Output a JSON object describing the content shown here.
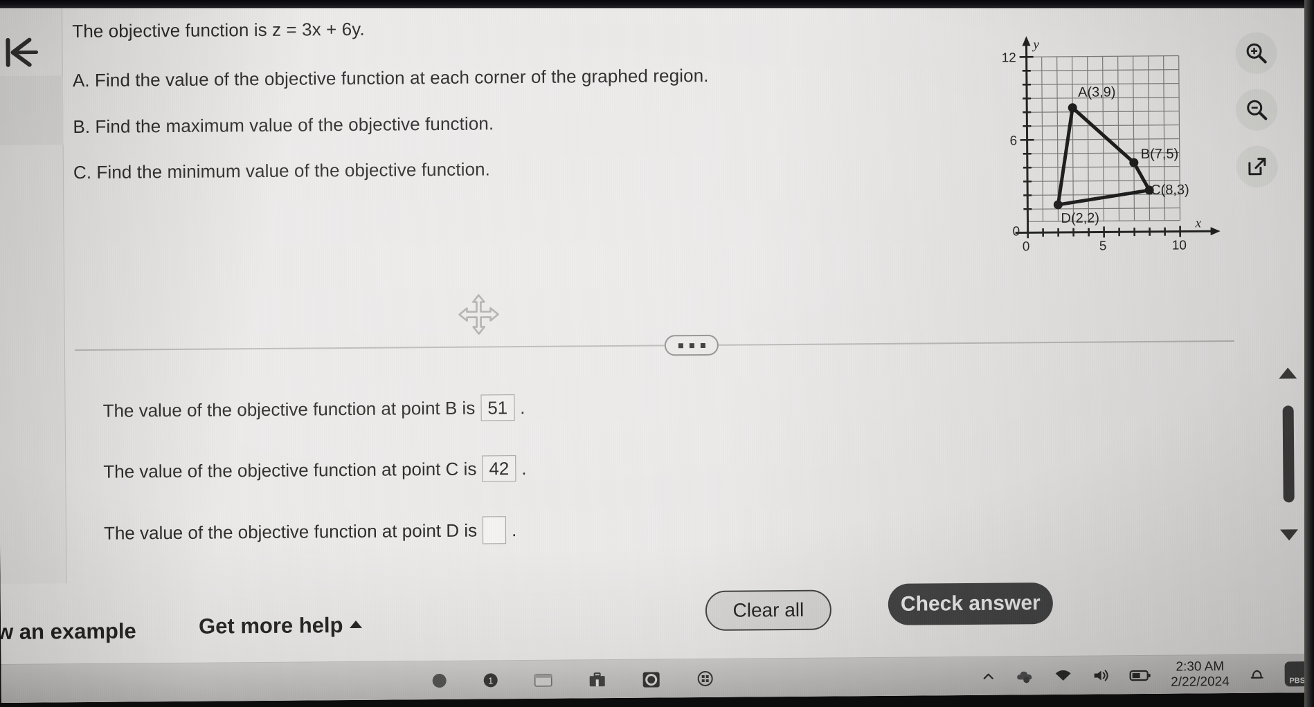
{
  "question": {
    "objective_line": "The objective function is z = 3x + 6y.",
    "parts": [
      "A. Find the value of the objective function at each corner of the graphed region.",
      "B. Find the maximum value of the objective function.",
      "C. Find the minimum value of the objective function."
    ]
  },
  "graph": {
    "y_axis_label": "y",
    "x_axis_label": "x",
    "x_ticks": [
      "0",
      "5",
      "10"
    ],
    "y_ticks": [
      "0",
      "6",
      "12"
    ],
    "origin_label": "0",
    "point_labels": [
      "A(3,9)",
      "B(7,5)",
      "C(8,3)",
      "D(2,2)"
    ]
  },
  "chart_data": {
    "type": "scatter",
    "title": "",
    "xlabel": "x",
    "ylabel": "y",
    "xlim": [
      0,
      11
    ],
    "ylim": [
      0,
      13
    ],
    "x_ticks": [
      0,
      5,
      10
    ],
    "y_ticks": [
      0,
      6,
      12
    ],
    "grid": true,
    "grid_step": 1,
    "legend": "none",
    "points": [
      {
        "label": "A(3,9)",
        "x": 3,
        "y": 9
      },
      {
        "label": "B(7,5)",
        "x": 7,
        "y": 5
      },
      {
        "label": "C(8,3)",
        "x": 8,
        "y": 3
      },
      {
        "label": "D(2,2)",
        "x": 2,
        "y": 2
      }
    ],
    "polygon": [
      "A",
      "B",
      "C",
      "D"
    ],
    "annotations": [
      "A(3,9)",
      "B(7,5)",
      "C(8,3)",
      "D(2,2)"
    ]
  },
  "answers": {
    "rows": [
      {
        "prefix": "The value of the objective function at point B is",
        "value": "51",
        "suffix": "."
      },
      {
        "prefix": "The value of the objective function at point C is",
        "value": "42",
        "suffix": "."
      },
      {
        "prefix": "The value of the objective function at point D is",
        "value": "",
        "suffix": "."
      }
    ]
  },
  "tools": {
    "zoom_in": "zoom-in",
    "zoom_out": "zoom-out",
    "expand": "open-in-new"
  },
  "footer": {
    "example_label": "w an example",
    "help_label": "Get more help",
    "clear_label": "Clear all",
    "check_label": "Check answer"
  },
  "taskbar": {
    "time": "2:30 AM",
    "date": "2/22/2024",
    "badge_label": "PBS"
  },
  "colors": {
    "page_bg": "#eceae7",
    "text": "#1d1d1d",
    "check_button_bg": "#3f3f3f",
    "check_button_text": "#f0efee",
    "graph_ink": "#1a1a1a",
    "grid": "#6d6d6d"
  }
}
